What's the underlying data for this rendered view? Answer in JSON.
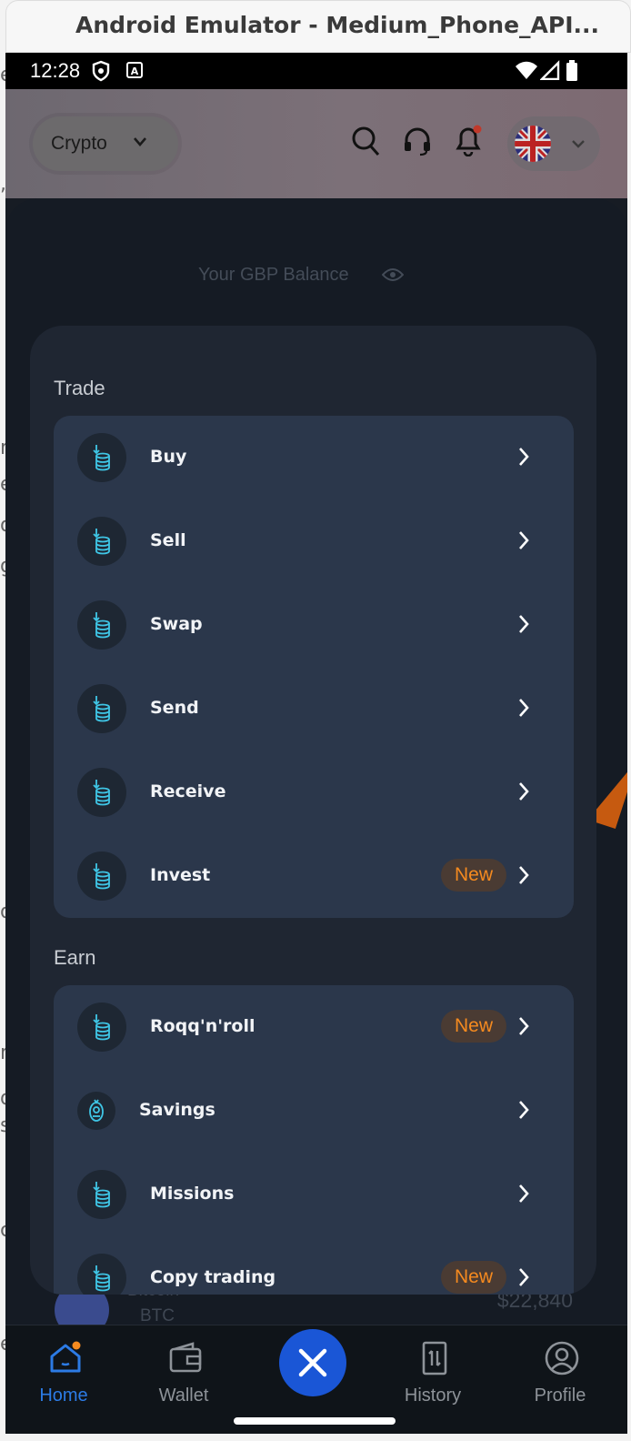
{
  "window": {
    "title": "Android Emulator - Medium_Phone_API..."
  },
  "status_bar": {
    "time": "12:28"
  },
  "header": {
    "mode_label": "Crypto"
  },
  "balance": {
    "label": "Your GBP Balance"
  },
  "trade": {
    "title": "Trade",
    "items": [
      {
        "label": "Buy",
        "badge": ""
      },
      {
        "label": "Sell",
        "badge": ""
      },
      {
        "label": "Swap",
        "badge": ""
      },
      {
        "label": "Send",
        "badge": ""
      },
      {
        "label": "Receive",
        "badge": ""
      },
      {
        "label": "Invest",
        "badge": "New"
      }
    ]
  },
  "earn": {
    "title": "Earn",
    "items": [
      {
        "label": "Roqq'n'roll",
        "badge": "New"
      },
      {
        "label": "Savings",
        "badge": ""
      },
      {
        "label": "Missions",
        "badge": ""
      },
      {
        "label": "Copy trading",
        "badge": "New"
      }
    ]
  },
  "behind_list": {
    "name": "Bitcoin",
    "symbol": "BTC",
    "value": "$22,840"
  },
  "nav": {
    "home": "Home",
    "wallet": "Wallet",
    "history": "History",
    "profile": "Profile"
  },
  "colors": {
    "accent": "#2c7be5",
    "fab": "#1a56d6",
    "badge_text": "#f58a1f",
    "icon_cyan": "#3fc6e6"
  }
}
